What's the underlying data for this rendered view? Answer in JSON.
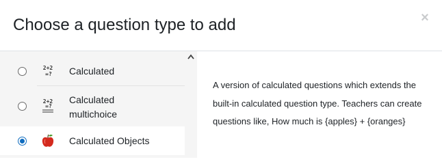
{
  "dialog": {
    "title": "Choose a question type to add",
    "close_symbol": "×"
  },
  "options": [
    {
      "label": "Calculated",
      "icon": "calculated-icon",
      "selected": false
    },
    {
      "label": "Calculated multichoice",
      "icon": "calculated-multichoice-icon",
      "selected": false
    },
    {
      "label": "Calculated Objects",
      "icon": "apple-icon",
      "selected": true
    }
  ],
  "icon_text": {
    "calc_top": "2+2",
    "calc_bottom": "=?",
    "multi_top": "2+2",
    "multi_bottom": "=?"
  },
  "description": "A version of calculated questions which extends the built-in calculated question type. Teachers can create questions like, How much is {apples} + {oranges}",
  "colors": {
    "accent": "#0f6cbf",
    "panel_bg": "#f5f5f5",
    "border": "#dee2e6"
  }
}
